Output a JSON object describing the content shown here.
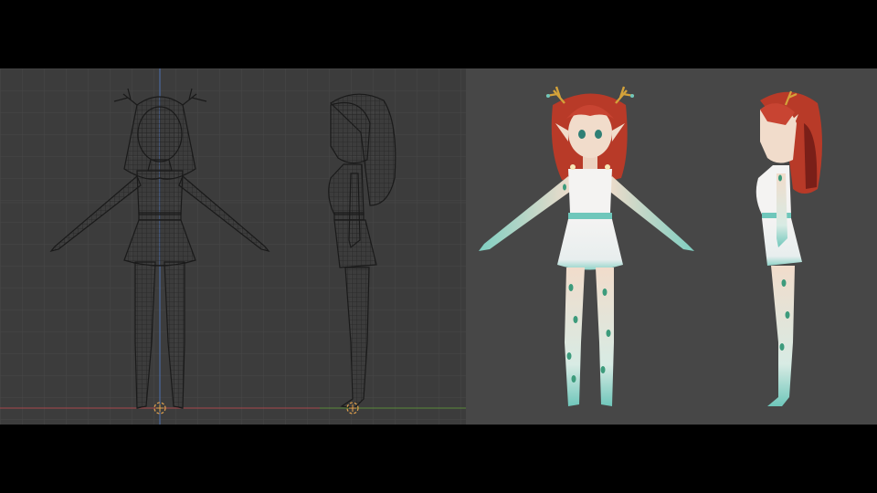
{
  "screen": {
    "background": "#000000",
    "panels": [
      {
        "name": "wireframe-viewport",
        "background": "#3c3c3c",
        "grid": true,
        "views": [
          "front",
          "side"
        ]
      },
      {
        "name": "render-viewport",
        "background": "#474747",
        "grid": false,
        "views": [
          "front",
          "side"
        ]
      }
    ]
  },
  "colors": {
    "grid_line": "#4a4a4a",
    "axis_blue": "#4d6fb0",
    "axis_red": "#a8474c",
    "axis_green": "#5a8a3a",
    "wire": "#1e1e1e",
    "hair": "#b83a28",
    "hair_dark": "#7a1f18",
    "skin": "#f1dccb",
    "dress": "#f4f3f2",
    "teal": "#6fc7bb",
    "leaf": "#3d9b7c",
    "antler": "#d4a23a",
    "origin_marker": "#e2a24d"
  },
  "icons": [
    "origin-marker-icon",
    "origin-marker-icon"
  ]
}
